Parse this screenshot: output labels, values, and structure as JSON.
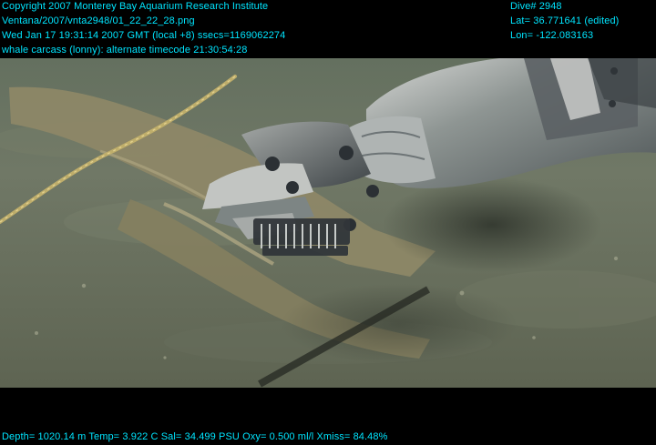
{
  "overlay": {
    "top_left": {
      "line1": "Copyright 2007 Monterey Bay Aquarium Research Institute",
      "line2": "Ventana/2007/vnta2948/01_22_22_28.png",
      "line3": "Wed Jan 17 19:31:14 2007 GMT (local +8)  ssecs=1169062274",
      "line4": "whale carcass (lonny): alternate timecode 21:30:54:28"
    },
    "top_right": {
      "line1": "Dive# 2948",
      "line2": "Lat= 36.771641 (edited)",
      "line3": "Lon= -122.083163"
    },
    "bottom": {
      "telemetry": "Depth= 1020.14 m  Temp= 3.922 C  Sal= 34.499 PSU  Oxy= 0.500 ml/l  Xmiss= 84.48%"
    }
  },
  "colors": {
    "overlay_text": "#00e5ff",
    "frame": "#000000",
    "seafloor": "#6b7560"
  }
}
